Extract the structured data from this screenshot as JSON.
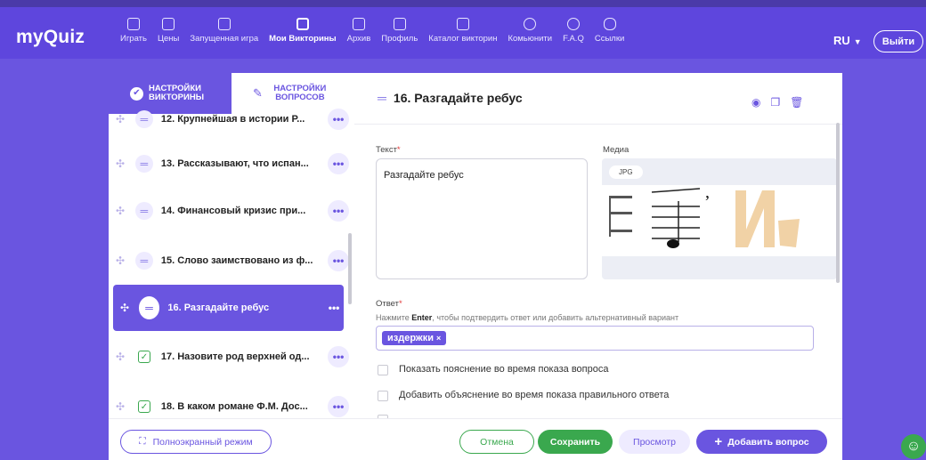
{
  "app": {
    "logo": "myQuiz"
  },
  "nav": [
    {
      "label": "Играть",
      "icon": "gamepad-icon"
    },
    {
      "label": "Цены",
      "icon": "price-icon"
    },
    {
      "label": "Запущенная игра",
      "icon": "rocket-icon"
    },
    {
      "label": "Мои Викторины",
      "icon": "quizzes-icon",
      "active": true
    },
    {
      "label": "Архив",
      "icon": "archive-icon"
    },
    {
      "label": "Профиль",
      "icon": "profile-icon"
    },
    {
      "label": "Каталог викторин",
      "icon": "catalog-icon"
    },
    {
      "label": "Комьюнити",
      "icon": "star-icon"
    },
    {
      "label": "F.A.Q",
      "icon": "help-icon"
    },
    {
      "label": "Ссылки",
      "icon": "link-icon"
    }
  ],
  "header": {
    "lang": "RU",
    "logout": "Выйти"
  },
  "tabs": {
    "quiz_settings": "НАСТРОЙКИ ВИКТОРИНЫ",
    "question_settings": "НАСТРОЙКИ ВОПРОСОВ"
  },
  "questions": [
    {
      "text": "12. Крупнейшая в истории Р...",
      "type": "text"
    },
    {
      "text": "13. Рассказывают, что испан...",
      "type": "text"
    },
    {
      "text": "14. Финансовый кризис при...",
      "type": "text"
    },
    {
      "text": "15. Слово заимствовано из ф...",
      "type": "text"
    },
    {
      "text": "16. Разгадайте ребус",
      "type": "text",
      "selected": true
    },
    {
      "text": "17. Назовите род верхней од...",
      "type": "choice"
    },
    {
      "text": "18. В каком романе Ф.М. Дос...",
      "type": "choice"
    }
  ],
  "editor": {
    "title": "16. Разгадайте ребус",
    "text_label": "Текст",
    "text_value": "Разгадайте ребус",
    "media_label": "Медиа",
    "media_badge": "JPG",
    "answer_label": "Ответ",
    "answer_hint_pre": "Нажмите",
    "answer_hint_key": "Enter",
    "answer_hint_post": ", чтобы подтвердить ответ или добавить альтернативный вариант",
    "answer_chip": "издержки",
    "opt1": "Показать пояснение во время показа вопроса",
    "opt2": "Добавить объяснение во время показа правильного ответа"
  },
  "bottom": {
    "fullscreen": "Полноэкранный режим",
    "cancel": "Отмена",
    "save": "Сохранить",
    "preview": "Просмотр",
    "add_question": "Добавить вопрос"
  }
}
